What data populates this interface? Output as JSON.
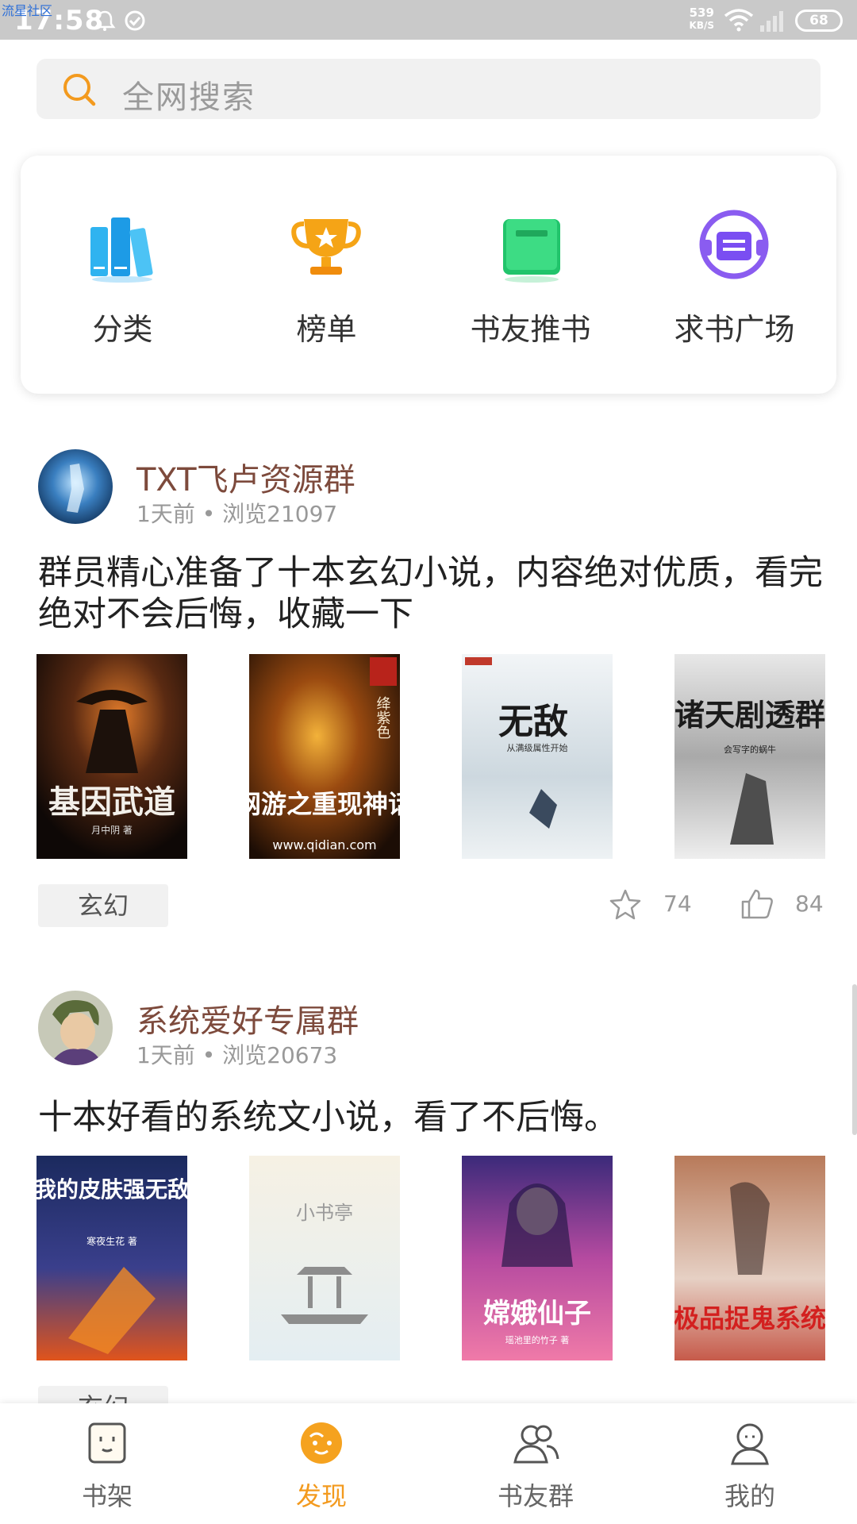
{
  "status_bar": {
    "watermark": "流星社区",
    "time": "17:58",
    "network_speed_value": "539",
    "network_speed_unit": "KB/S",
    "battery": "68"
  },
  "search": {
    "placeholder": "全网搜索"
  },
  "quick_links": [
    {
      "label": "分类",
      "icon": "books-icon"
    },
    {
      "label": "榜单",
      "icon": "trophy-icon"
    },
    {
      "label": "书友推书",
      "icon": "book-icon"
    },
    {
      "label": "求书广场",
      "icon": "headphone-book-icon"
    }
  ],
  "posts": [
    {
      "title": "TXT飞卢资源群",
      "meta": "1天前 • 浏览21097",
      "text": "群员精心准备了十本玄幻小说，内容绝对优质，看完绝对不会后悔，收藏一下",
      "covers": [
        {
          "title": "基因武道",
          "author": "月中阴 著"
        },
        {
          "title": "网游之重现神话",
          "author": "绛紫色",
          "site": "www.qidian.com"
        },
        {
          "title": "无敌",
          "subtitle": "从满级属性开始"
        },
        {
          "title": "诸天剧透群",
          "author": "会写字的蜗牛"
        }
      ],
      "tag": "玄幻",
      "favorites": "74",
      "likes": "84"
    },
    {
      "title": "系统爱好专属群",
      "meta": "1天前 • 浏览20673",
      "text": "十本好看的系统文小说，看了不后悔。",
      "covers": [
        {
          "title": "我的皮肤强无敌",
          "author": "寒夜生花 著"
        },
        {
          "title": "小书亭"
        },
        {
          "title": "嫦娥仙子",
          "author": "瑶池里的竹子 著"
        },
        {
          "title": "极品捉鬼系统"
        }
      ],
      "tag": "玄幻"
    }
  ],
  "bottom_nav": [
    {
      "label": "书架",
      "icon": "bookshelf-icon"
    },
    {
      "label": "发现",
      "icon": "discover-icon",
      "active": true
    },
    {
      "label": "书友群",
      "icon": "group-icon"
    },
    {
      "label": "我的",
      "icon": "profile-icon"
    }
  ],
  "colors": {
    "accent": "#f39a1e",
    "post_title": "#7d4a3c"
  }
}
